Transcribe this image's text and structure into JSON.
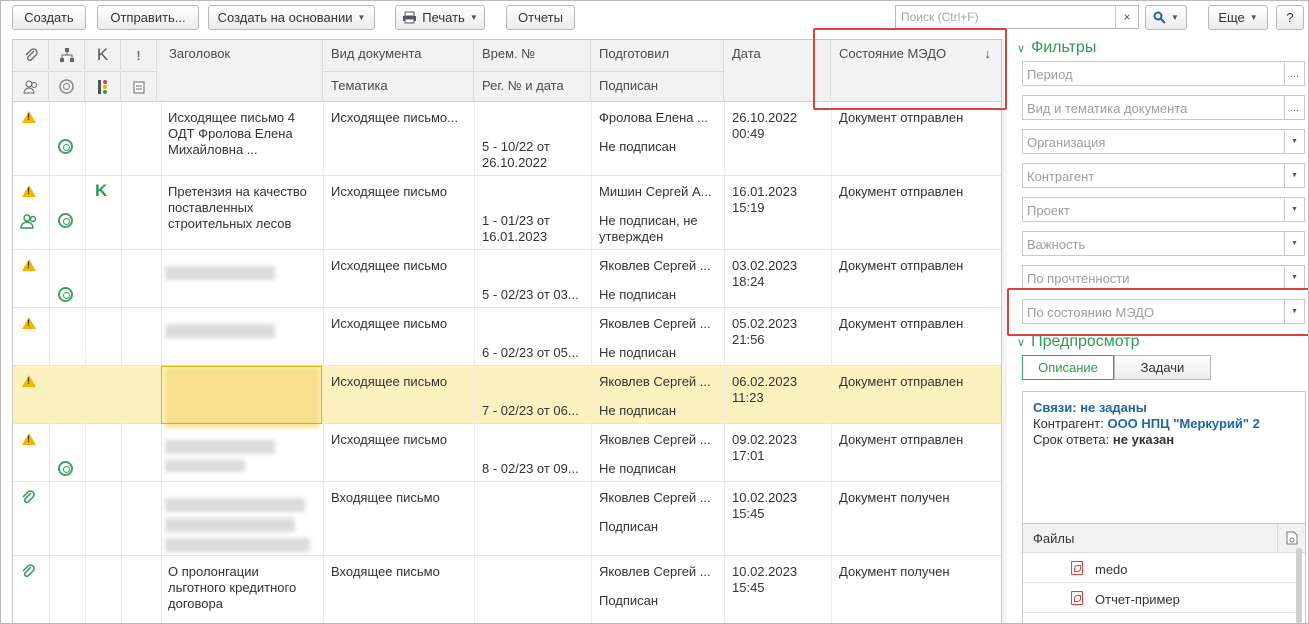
{
  "toolbar": {
    "create": "Создать",
    "send": "Отправить...",
    "create_based": "Создать на основании",
    "print": "Печать",
    "reports": "Отчеты",
    "search_placeholder": "Поиск (Ctrl+F)",
    "more": "Еще",
    "help": "?"
  },
  "columns": {
    "top": [
      "Заголовок",
      "Вид документа",
      "Врем. №",
      "Подготовил",
      "Дата",
      "Состояние МЭДО"
    ],
    "bottom": [
      "Тематика",
      "Рег. № и дата",
      "Подписан"
    ],
    "k_letter": "K",
    "sort_arrow": "↓"
  },
  "rows": [
    {
      "title": "Исходящее письмо 4 ОДТ Фролова Елена Михайловна ...",
      "doctype": "Исходящее письмо...",
      "regnum": "5 - 10/22 от 26.10.2022",
      "preparer": "Фролова Елена ...",
      "signed": "Не подписан",
      "date": "26.10.2022\n00:49",
      "status": "Документ отправлен",
      "icons": [
        "warning-icon",
        "state-ring-icon"
      ]
    },
    {
      "title": "Претензия на качество поставленных строительных лесов",
      "doctype": "Исходящее письмо",
      "regnum": "1 - 01/23 от 16.01.2023",
      "preparer": "Мишин Сергей А...",
      "signed": "Не подписан, не утвержден",
      "date": "16.01.2023\n15:19",
      "status": "Документ отправлен",
      "icons": [
        "warning-icon",
        "k-icon",
        "users-icon",
        "state-ring-icon"
      ]
    },
    {
      "title": "",
      "doctype": "Исходящее письмо",
      "regnum": "5 - 02/23 от 03...",
      "preparer": "Яковлев Сергей ...",
      "signed": "Не подписан",
      "date": "03.02.2023\n18:24",
      "status": "Документ отправлен",
      "icons": [
        "warning-icon",
        "state-ring-icon"
      ]
    },
    {
      "title": "",
      "doctype": "Исходящее письмо",
      "regnum": "6 - 02/23 от 05...",
      "preparer": "Яковлев Сергей ...",
      "signed": "Не подписан",
      "date": "05.02.2023\n21:56",
      "status": "Документ отправлен",
      "icons": [
        "warning-icon"
      ]
    },
    {
      "title": "",
      "doctype": "Исходящее письмо",
      "regnum": "7 - 02/23 от 06...",
      "preparer": "Яковлев Сергей ...",
      "signed": "Не подписан",
      "date": "06.02.2023\n11:23",
      "status": "Документ отправлен",
      "icons": [
        "warning-icon"
      ],
      "selected": true
    },
    {
      "title": "",
      "doctype": "Исходящее письмо",
      "regnum": "8 - 02/23 от 09...",
      "preparer": "Яковлев Сергей ...",
      "signed": "Не подписан",
      "date": "09.02.2023\n17:01",
      "status": "Документ отправлен",
      "icons": [
        "warning-icon",
        "state-ring-icon"
      ]
    },
    {
      "title": "",
      "doctype": "Входящее письмо",
      "regnum": "",
      "preparer": "Яковлев Сергей ...",
      "signed": "Подписан",
      "date": "10.02.2023\n15:45",
      "status": "Документ получен",
      "icons": [
        "paperclip-icon"
      ]
    },
    {
      "title": "О пролонгации льготного кредитного договора",
      "doctype": "Входящее письмо",
      "regnum": "",
      "preparer": "Яковлев Сергей ...",
      "signed": "Подписан",
      "date": "10.02.2023\n15:45",
      "status": "Документ получен",
      "icons": [
        "paperclip-icon"
      ]
    }
  ],
  "filters": {
    "title": "Фильтры",
    "fields": [
      "Период",
      "Вид и тематика документа",
      "Организация",
      "Контрагент",
      "Проект",
      "Важность",
      "По прочтенности",
      "По состоянию МЭДО"
    ],
    "ellipsis": "..."
  },
  "preview": {
    "title": "Предпросмотр",
    "tabs": [
      "Описание",
      "Задачи"
    ],
    "links_label": "Связи: не заданы",
    "counterparty_label": "Контрагент:",
    "counterparty_value": "ООО НПЦ \"Меркурий\" 2",
    "deadline_label": "Срок ответа:",
    "deadline_value": "не указан",
    "files_title": "Файлы",
    "files": [
      "medo",
      "Отчет-пример"
    ]
  },
  "colors": {
    "accent": "#2e9a58",
    "highlight": "#d9423d",
    "selected_row": "#fcf2c0",
    "link": "#1b67a3"
  }
}
